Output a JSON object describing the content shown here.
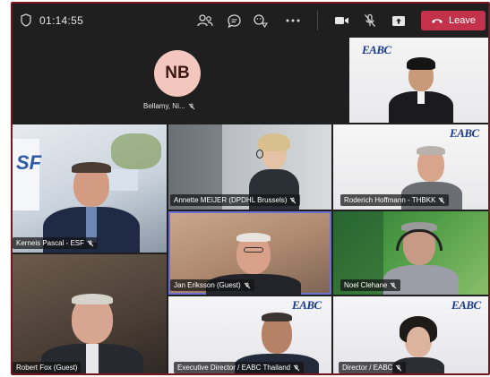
{
  "meeting": {
    "timer": "01:14:55",
    "leave_label": "Leave",
    "icons": [
      "shield-icon",
      "people-icon",
      "chat-icon",
      "reactions-icon",
      "more-icon",
      "camera-icon",
      "mic-muted-icon",
      "share-icon",
      "phone-icon"
    ]
  },
  "participants": [
    {
      "initials": "NB",
      "name": "Bellamy, Ni..."
    },
    {
      "name": ""
    },
    {
      "name": "Kerneis Pascal - ESF"
    },
    {
      "name": "Annette MEIJER (DPDHL Brussels)"
    },
    {
      "name": "Roderich Hoffmann - THBKK"
    },
    {
      "name": "Jan Eriksson (Guest)"
    },
    {
      "name": "Noel Clehane"
    },
    {
      "name": "Robert Fox (Guest)"
    },
    {
      "name": "Executive Director / EABC Thailand"
    },
    {
      "name": "Director / EABC"
    }
  ],
  "branding": {
    "logo_text": "EABC",
    "accent": "#c4314b",
    "logo_color": "#1a3a8a"
  }
}
